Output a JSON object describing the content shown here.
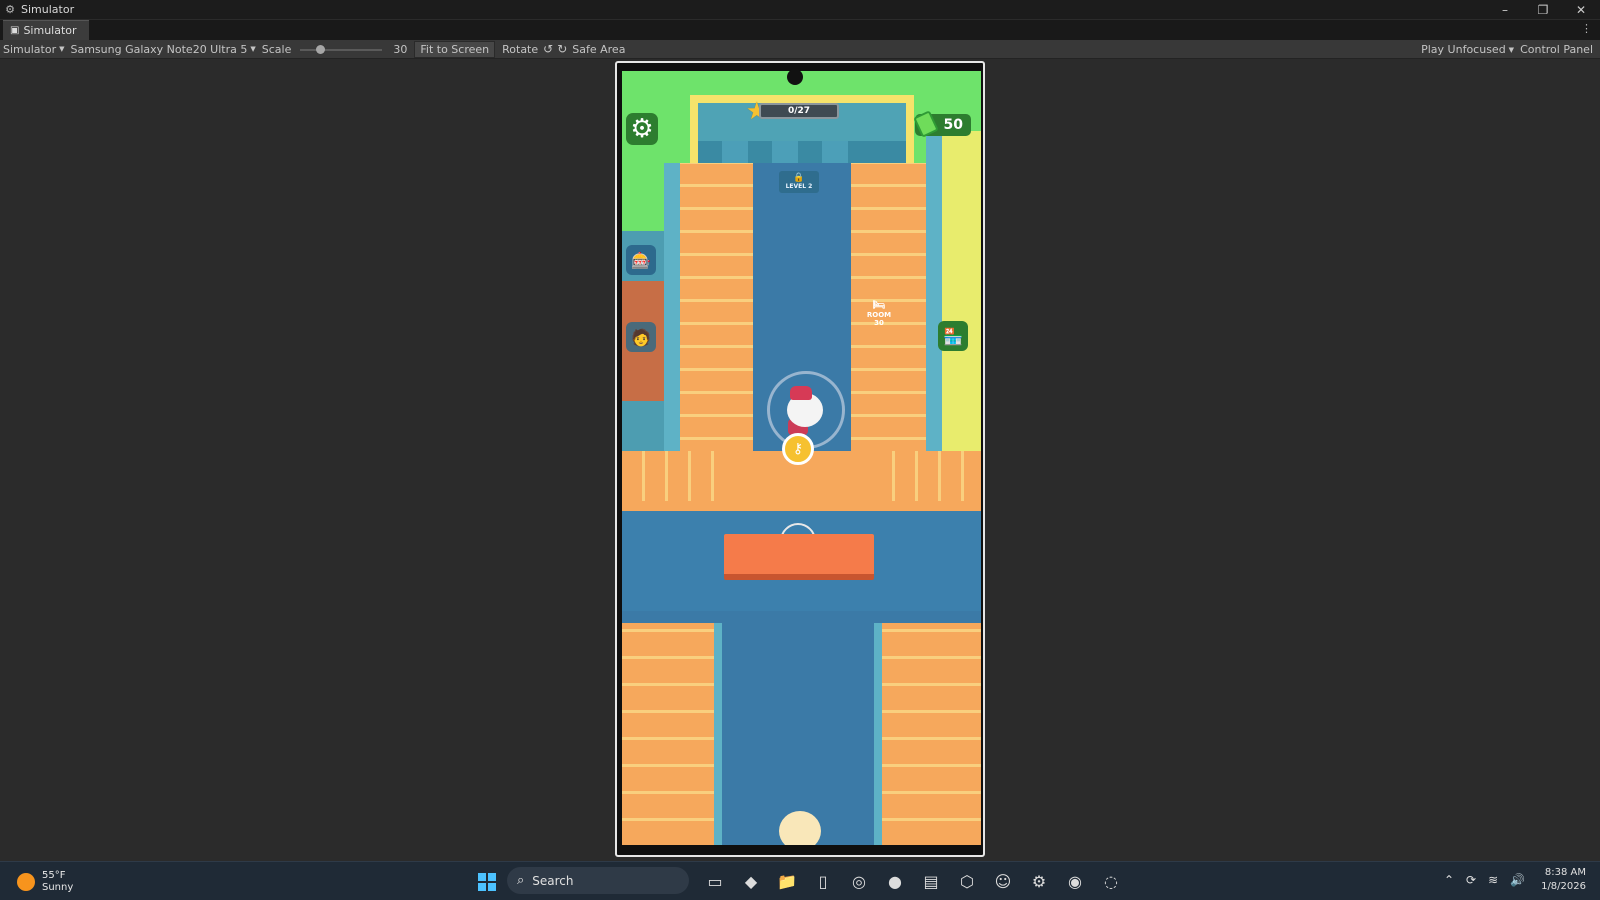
{
  "window": {
    "title": "Simulator",
    "controls": [
      "–",
      "❐",
      "✕"
    ]
  },
  "tabs": [
    {
      "label": "Simulator",
      "active": true
    }
  ],
  "toolbar": {
    "mode": "Simulator",
    "device": "Samsung Galaxy Note20 Ultra 5",
    "scale_label": "Scale",
    "scale_value": "30",
    "fit_button": "Fit to Screen",
    "rotate_label": "Rotate",
    "safe_area": "Safe Area",
    "play_mode": "Play Unfocused",
    "control_panel": "Control Panel"
  },
  "game": {
    "stars_progress": "0/27",
    "stars_fraction": 0,
    "money": "50",
    "level_door": "LEVEL 2",
    "room_sign": "ROOM",
    "room_price": "30"
  },
  "taskbar": {
    "weather_temp": "55°F",
    "weather_desc": "Sunny",
    "search_placeholder": "Search",
    "time": "8:38 AM",
    "date": "1/8/2026"
  },
  "colors": {
    "grass": "#6ee36b",
    "corridor": "#3b7aa7",
    "floor": "#f6a85c",
    "counter": "#f57b4a",
    "ui_green": "#2d7d2f",
    "star": "#f6c130"
  }
}
